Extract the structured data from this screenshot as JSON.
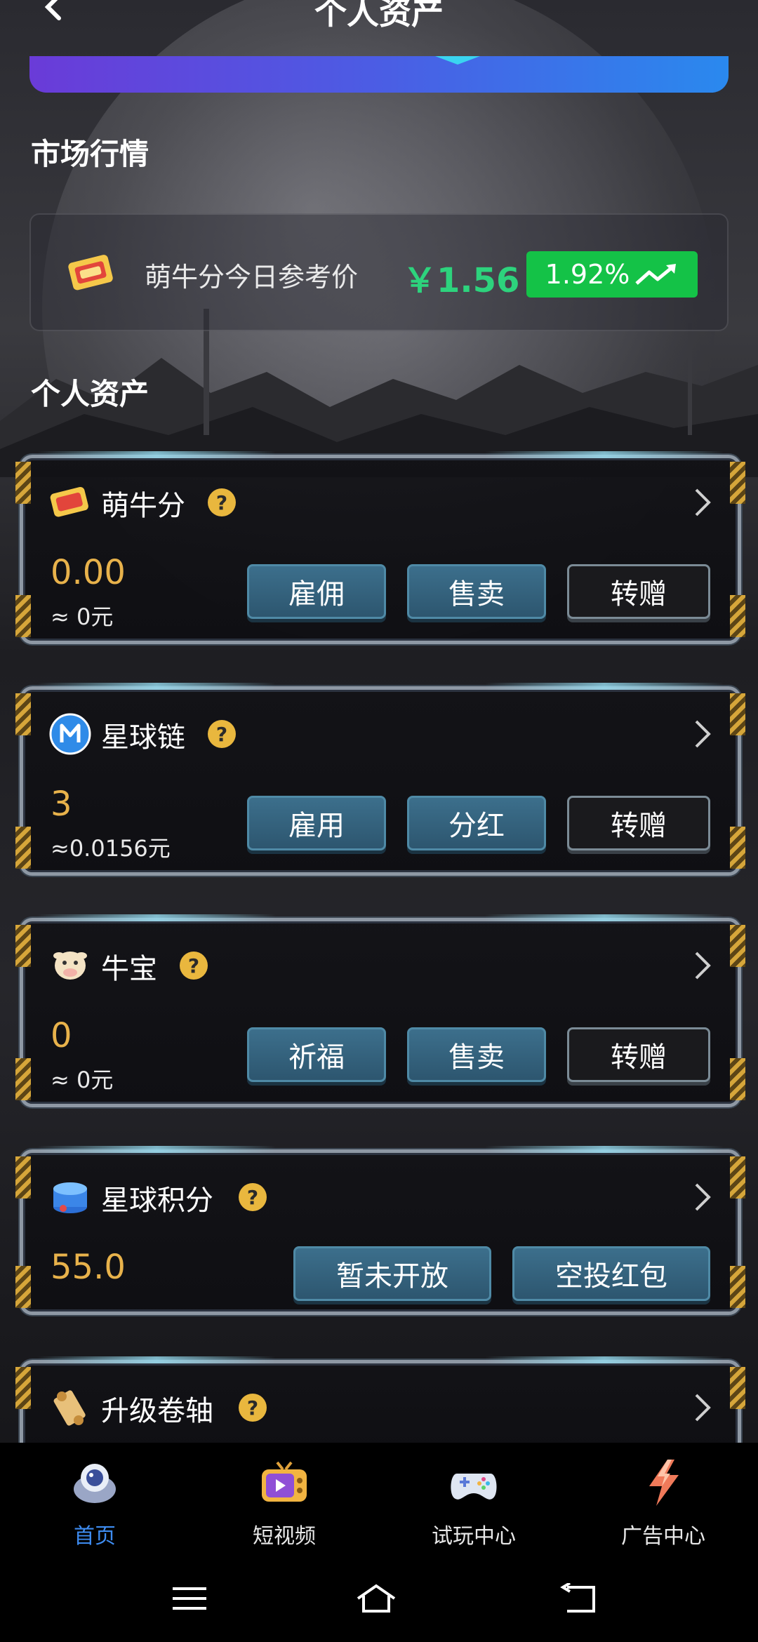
{
  "header": {
    "title": "个人资产"
  },
  "sections": {
    "market_title": "市场行情",
    "assets_title": "个人资产"
  },
  "market": {
    "label": "萌牛分今日参考价",
    "price": "￥1.56",
    "change": "1.92%",
    "change_color": "#14c247"
  },
  "assets": [
    {
      "name": "萌牛分",
      "value": "0.00",
      "sub": "≈ 0元",
      "buttons": [
        "雇佣",
        "售卖",
        "转赠"
      ]
    },
    {
      "name": "星球链",
      "value": "3",
      "sub": "≈0.0156元",
      "buttons": [
        "雇用",
        "分红",
        "转赠"
      ]
    },
    {
      "name": "牛宝",
      "value": "0",
      "sub": "≈ 0元",
      "buttons": [
        "祈福",
        "售卖",
        "转赠"
      ]
    },
    {
      "name": "星球积分",
      "value": "55.0",
      "buttons": [
        "暂未开放",
        "空投红包"
      ]
    },
    {
      "name": "升级卷轴"
    }
  ],
  "help_symbol": "?",
  "bottom_nav": [
    {
      "label": "首页",
      "icon": "astronaut-icon",
      "active": true
    },
    {
      "label": "短视频",
      "icon": "tv-icon",
      "active": false
    },
    {
      "label": "试玩中心",
      "icon": "gamepad-icon",
      "active": false
    },
    {
      "label": "广告中心",
      "icon": "lightning-icon",
      "active": false
    }
  ],
  "colors": {
    "accent_active": "#3e8cf1",
    "value_gold": "#e8b24b",
    "price_green": "#2dd37d"
  }
}
